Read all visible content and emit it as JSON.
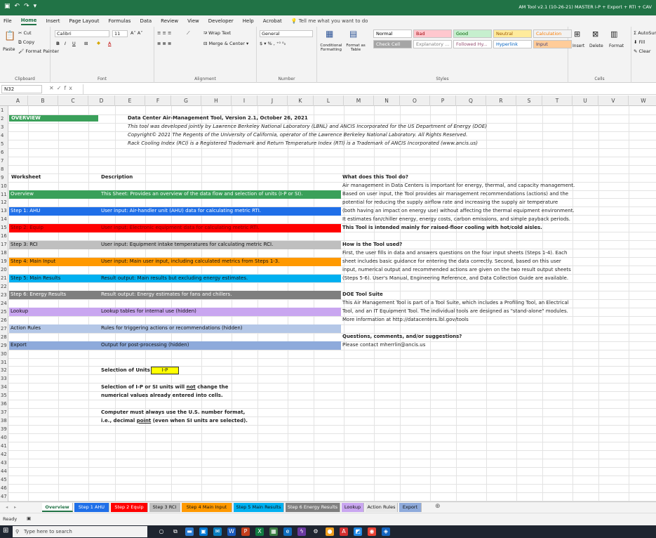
{
  "window": {
    "title": "AM Tool v2.1 (10-26-21) MASTER I-P + Export + RTI + CAV"
  },
  "menu_tabs": [
    "File",
    "Home",
    "Insert",
    "Page Layout",
    "Formulas",
    "Data",
    "Review",
    "View",
    "Developer",
    "Help",
    "Acrobat"
  ],
  "tell_me": "Tell me what you want to do",
  "ribbon": {
    "clipboard": {
      "paste": "Paste",
      "cut": "Cut",
      "copy": "Copy",
      "format_painter": "Format Painter",
      "label": "Clipboard"
    },
    "font": {
      "name": "Calibri",
      "size": "11",
      "label": "Font"
    },
    "alignment": {
      "wrap": "Wrap Text",
      "merge": "Merge & Center",
      "label": "Alignment"
    },
    "number": {
      "format": "General",
      "label": "Number"
    },
    "styles": {
      "cond": "Conditional Formatting",
      "format_table": "Format as Table",
      "label": "Styles",
      "cells": [
        {
          "text": "Normal",
          "bg": "#ffffff",
          "fg": "#000000"
        },
        {
          "text": "Bad",
          "bg": "#ffc7ce",
          "fg": "#9c0006"
        },
        {
          "text": "Good",
          "bg": "#c6efce",
          "fg": "#006100"
        },
        {
          "text": "Neutral",
          "bg": "#ffeb9c",
          "fg": "#9c5700"
        },
        {
          "text": "Calculation",
          "bg": "#f2f2f2",
          "fg": "#fa7d00"
        },
        {
          "text": "Check Cell",
          "bg": "#a5a5a5",
          "fg": "#ffffff"
        },
        {
          "text": "Explanatory ...",
          "bg": "#ffffff",
          "fg": "#7f7f7f"
        },
        {
          "text": "Followed Hy...",
          "bg": "#ffffff",
          "fg": "#954f72"
        },
        {
          "text": "Hyperlink",
          "bg": "#ffffff",
          "fg": "#0563c1"
        },
        {
          "text": "Input",
          "bg": "#ffcc99",
          "fg": "#3f3f76"
        }
      ]
    },
    "cells": {
      "insert": "Insert",
      "delete": "Delete",
      "format": "Format",
      "label": "Cells"
    },
    "editing": {
      "autosum": "AutoSum",
      "fill": "Fill",
      "clear": "Clear"
    }
  },
  "name_box": "N32",
  "columns": [
    "A",
    "B",
    "C",
    "D",
    "E",
    "F",
    "G",
    "H",
    "I",
    "J",
    "K",
    "L",
    "M",
    "N",
    "O",
    "P",
    "Q",
    "R",
    "S",
    "T",
    "U",
    "V",
    "W",
    "X"
  ],
  "rows": [
    "1",
    "2",
    "3",
    "4",
    "5",
    "6",
    "7",
    "8",
    "9",
    "10",
    "11",
    "12",
    "13",
    "14",
    "15",
    "16",
    "17",
    "18",
    "19",
    "20",
    "21",
    "22",
    "23",
    "24",
    "25",
    "26",
    "27",
    "28",
    "29",
    "30",
    "31",
    "32",
    "33",
    "34",
    "35",
    "36",
    "37",
    "38",
    "39",
    "40",
    "41",
    "42",
    "43",
    "44",
    "45",
    "46",
    "47"
  ],
  "overview_label": "OVERVIEW",
  "header_lines": [
    "Data Center Air-Management Tool, Version 2.1, October 26, 2021",
    "This tool was developed jointly by Lawrence Berkeley National Laboratory (LBNL) and ANCIS Incorporated for the US Department of Energy (DOE)",
    "Copyright© 2021 The Regents of the University of California, operator of the Lawrence Berkeley National Laboratory.  All Rights Reserved.",
    "Rack Cooling Index (RCI) is a Registered Trademark and Return Temperature Index (RTI) is a Trademark of ANCIS Incorporated (www.ancis.us)"
  ],
  "worksheet_header": "Worksheet",
  "description_header": "Description",
  "worksheet_rows": [
    {
      "name": "Overview",
      "desc": "This Sheet: Provides an overview of the data flow and selection of units (I-P or SI).",
      "bg": "#3aa05a",
      "fg": "#ffffff"
    },
    {
      "name": "Step 1: AHU",
      "desc": "User input: Air-handler unit (AHU) data for calculating metric RTI.",
      "bg": "#1f6fe8",
      "fg": "#ffffff"
    },
    {
      "name": "Step 2: Equip",
      "desc": "User input: Electronic equipment data for calculating metric RTI.",
      "bg": "#ff0000",
      "fg": "#7a0000"
    },
    {
      "name": "Step 3: RCI",
      "desc": "User input: Equipment intake temperatures for calculating metric RCI.",
      "bg": "#bfbfbf",
      "fg": "#111111"
    },
    {
      "name": "Step 4: Main Input",
      "desc": "User input: Main user input, including calculated metrics from Steps 1-3.",
      "bg": "#ff9900",
      "fg": "#111111"
    },
    {
      "name": "Step 5: Main Results",
      "desc": "Result output: Main results but excluding energy estimates.",
      "bg": "#00b0f0",
      "fg": "#111111"
    },
    {
      "name": "Step 6: Energy Results",
      "desc": "Result output: Energy estimates for fans and chillers.",
      "bg": "#7f7f7f",
      "fg": "#ffffff"
    },
    {
      "name": "Lookup",
      "desc": "Lookup tables for internal use (hidden)",
      "bg": "#c9a6f0",
      "fg": "#111111"
    },
    {
      "name": "Action Rules",
      "desc": "Rules for triggering actions or recommendations (hidden)",
      "bg": "#b4c7e7",
      "fg": "#111111"
    },
    {
      "name": "Export",
      "desc": "Output for post-processing (hidden)",
      "bg": "#8eaadb",
      "fg": "#111111"
    }
  ],
  "right_panel": {
    "q1": "What does this Tool do?",
    "q1_lines": [
      "Air management in Data Centers is important for energy, thermal, and capacity management.",
      "Based on user input, the Tool provides air management recommendations (actions) and the",
      "potential for reducing the supply airflow rate and increasing the supply air temperature",
      "(both having an impact on energy use) without affecting the thermal equipment environment.",
      "It estimates fan/chiller energy, energy costs, carbon emissions, and simple payback periods."
    ],
    "q1_bold": "This Tool is intended mainly for raised-floor cooling with hot/cold aisles.",
    "q2": "How is the Tool used?",
    "q2_lines": [
      "First, the user fills in data and answers questions on the four input sheets (Steps 1-4). Each",
      "sheet includes basic guidance for entering the data correctly. Second, based on this user",
      "input, numerical output and recommended actions are given on the two result output sheets",
      "(Steps 5-6). User's Manual, Engineering Reference, and Data Collection Guide are available."
    ],
    "q3": "DOE Tool Suite",
    "q3_lines": [
      "This Air Management Tool is part of a Tool Suite, which includes a Profiling Tool, an Electrical",
      "Tool, and an IT Equipment Tool. The individual tools are designed as \"stand-alone\" modules.",
      "More information at http://datacenters.lbl.gov/tools"
    ],
    "q4": "Questions, comments, and/or suggestions?",
    "q4_line": "Please contact mherrlin@ancis.us"
  },
  "units": {
    "label": "Selection of Units",
    "value": "I-P",
    "note1a": "Selection of I-P or SI units will ",
    "note1_not": "not",
    "note1b": " change the",
    "note2": "numerical values already entered into cells.",
    "note3": "Computer must always use the U.S. number format,",
    "note4a": "i.e., decimal ",
    "note4_point": "point",
    "note4b": " (even when SI units are selected)."
  },
  "sheet_tabs": [
    {
      "label": "Overview",
      "bg": "#ffffff",
      "fg": "#217346",
      "active": true
    },
    {
      "label": "Step 1 AHU",
      "bg": "#1f6fe8",
      "fg": "#ffffff"
    },
    {
      "label": "Step 2 Equip",
      "bg": "#ff0000",
      "fg": "#ffffff"
    },
    {
      "label": "Step 3 RCI",
      "bg": "#bfbfbf",
      "fg": "#111111"
    },
    {
      "label": "Step 4 Main Input",
      "bg": "#ff9900",
      "fg": "#111111"
    },
    {
      "label": "Step 5 Main Results",
      "bg": "#00b0f0",
      "fg": "#111111"
    },
    {
      "label": "Step 6 Energy Results",
      "bg": "#7f7f7f",
      "fg": "#ffffff"
    },
    {
      "label": "Lookup",
      "bg": "#c9a6f0",
      "fg": "#111111"
    },
    {
      "label": "Action Rules",
      "bg": "#e8e8e8",
      "fg": "#111111"
    },
    {
      "label": "Export",
      "bg": "#8eaadb",
      "fg": "#111111"
    }
  ],
  "status": {
    "ready": "Ready"
  },
  "taskbar": {
    "search": "Type here to search"
  }
}
